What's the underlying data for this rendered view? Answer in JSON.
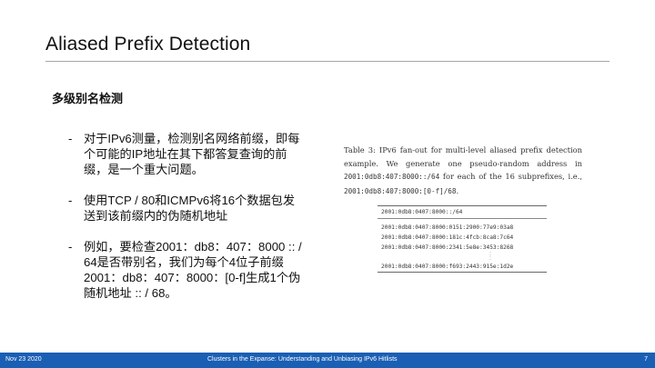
{
  "slide": {
    "title": "Aliased Prefix Detection",
    "subheading": "多级别名检测",
    "bullets": [
      {
        "marker": "-",
        "text": "对于IPv6测量，检测别名网络前缀，即每个可能的IP地址在其下都答复查询的前缀，是一个重大问题。"
      },
      {
        "marker": "-",
        "text": "使用TCP / 80和ICMPv6将16个数据包发送到该前缀内的伪随机地址"
      },
      {
        "marker": "-",
        "text": "例如，要检查2001：db8：407：8000 :: / 64是否带别名，我们为每个4位子前缀2001：db8：407：8000：[0-f]生成1个伪随机地址 :: / 68。"
      }
    ]
  },
  "figure": {
    "caption_lead": "Table 3: IPv6 fan-out for multi-level aliased prefix detection example. We generate one pseudo-random address in ",
    "caption_prefix": "2001:0db8:407:8000::/64",
    "caption_mid": " for each of the 16 subprefixes, i.e., ",
    "caption_subprefix": "2001:0db8:407:8000:[0-f]/68",
    "caption_end": ".",
    "table_header": "2001:0db8:0407:8000::/64",
    "rows": [
      "2001:0db8:0407:8000:0151:2900:77e9:03a8",
      "2001:0db8:0407:8000:181c:4fcb:8ca8:7c64",
      "2001:0db8:0407:8000:2341:5e8e:3453:8268"
    ],
    "ellipsis": ":",
    "last_row": "2001:0db8:0407:8000:f693:2443:915e:1d2e"
  },
  "footer": {
    "date": "Nov 23 2020",
    "center": "Clusters in the Expanse: Understanding and Unbiasing IPv6 Hitlists",
    "page": "7"
  }
}
